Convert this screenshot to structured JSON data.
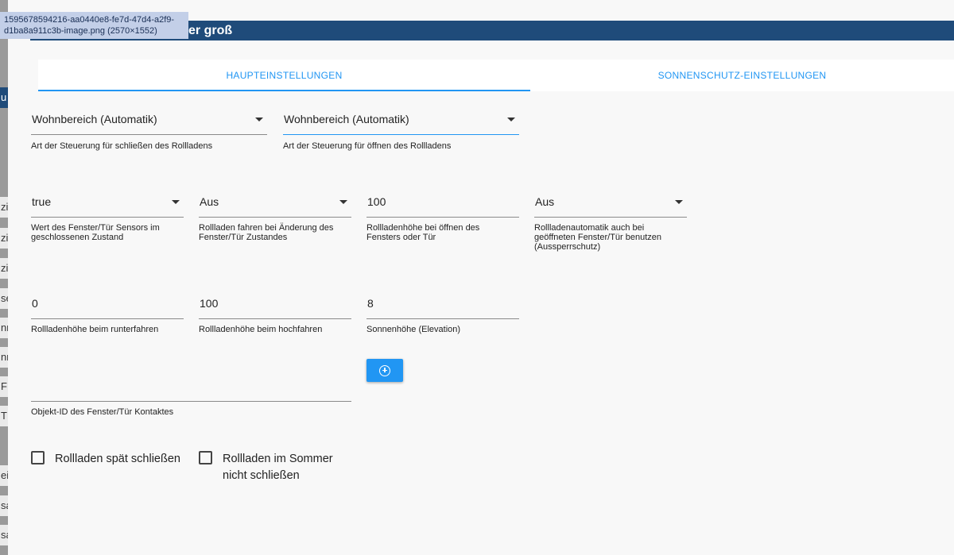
{
  "tooltip": {
    "line1": "1595678594216-aa0440e8-fe7d-47d4-a2f9-",
    "line2": "d1ba8a911c3b-image.png (2570×1552)"
  },
  "dialog": {
    "title_fragment": "er groß"
  },
  "background_fragments": [
    "u",
    "zi",
    "zi",
    "zi",
    "se",
    "nn",
    "nn",
    "F",
    "T",
    "ei",
    "sa",
    "sa"
  ],
  "tabs": {
    "main": "HAUPTEINSTELLUNGEN",
    "sun": "SONNENSCHUTZ-EINSTELLUNGEN"
  },
  "row1": {
    "close_control": {
      "value": "Wohnbereich (Automatik)",
      "help": "Art der Steuerung für schließen des Rollladens"
    },
    "open_control": {
      "value": "Wohnbereich (Automatik)",
      "help": "Art der Steuerung für öffnen des Rollladens"
    }
  },
  "row2": {
    "sensor_closed_value": {
      "value": "true",
      "help_line1": "Wert des Fenster/Tür Sensors im",
      "help_line2": "geschlossenen Zustand"
    },
    "move_on_change": {
      "value": "Aus",
      "help_line1": "Rollladen fahren bei Änderung des",
      "help_line2": "Fenster/Tür Zustandes"
    },
    "height_on_open": {
      "value": "100",
      "help_line1": "Rollladenhöhe bei öffnen des",
      "help_line2": "Fensters oder Tür"
    },
    "lockout_protection": {
      "value": "Aus",
      "help_line1": "Rollladenautomatik auch bei",
      "help_line2": "geöffneten Fenster/Tür benutzen",
      "help_line3": "(Aussperrschutz)"
    }
  },
  "row3": {
    "height_down": {
      "value": "0",
      "help": "Rollladenhöhe beim runterfahren"
    },
    "height_up": {
      "value": "100",
      "help": "Rollladenhöhe beim hochfahren"
    },
    "sun_elevation": {
      "value": "8",
      "help": "Sonnenhöhe (Elevation)"
    }
  },
  "object_id": {
    "value": "",
    "help": "Objekt-ID des Fenster/Tür Kontaktes"
  },
  "checkboxes": {
    "late_close": {
      "label": "Rollladen spät schließen",
      "checked": false
    },
    "summer_no_close": {
      "label_line1": "Rollladen im Sommer",
      "label_line2": "nicht schließen",
      "checked": false
    }
  },
  "colors": {
    "accent": "#2196f3",
    "header": "#1f4b7a",
    "tooltip_bg": "#c3cfe8"
  }
}
